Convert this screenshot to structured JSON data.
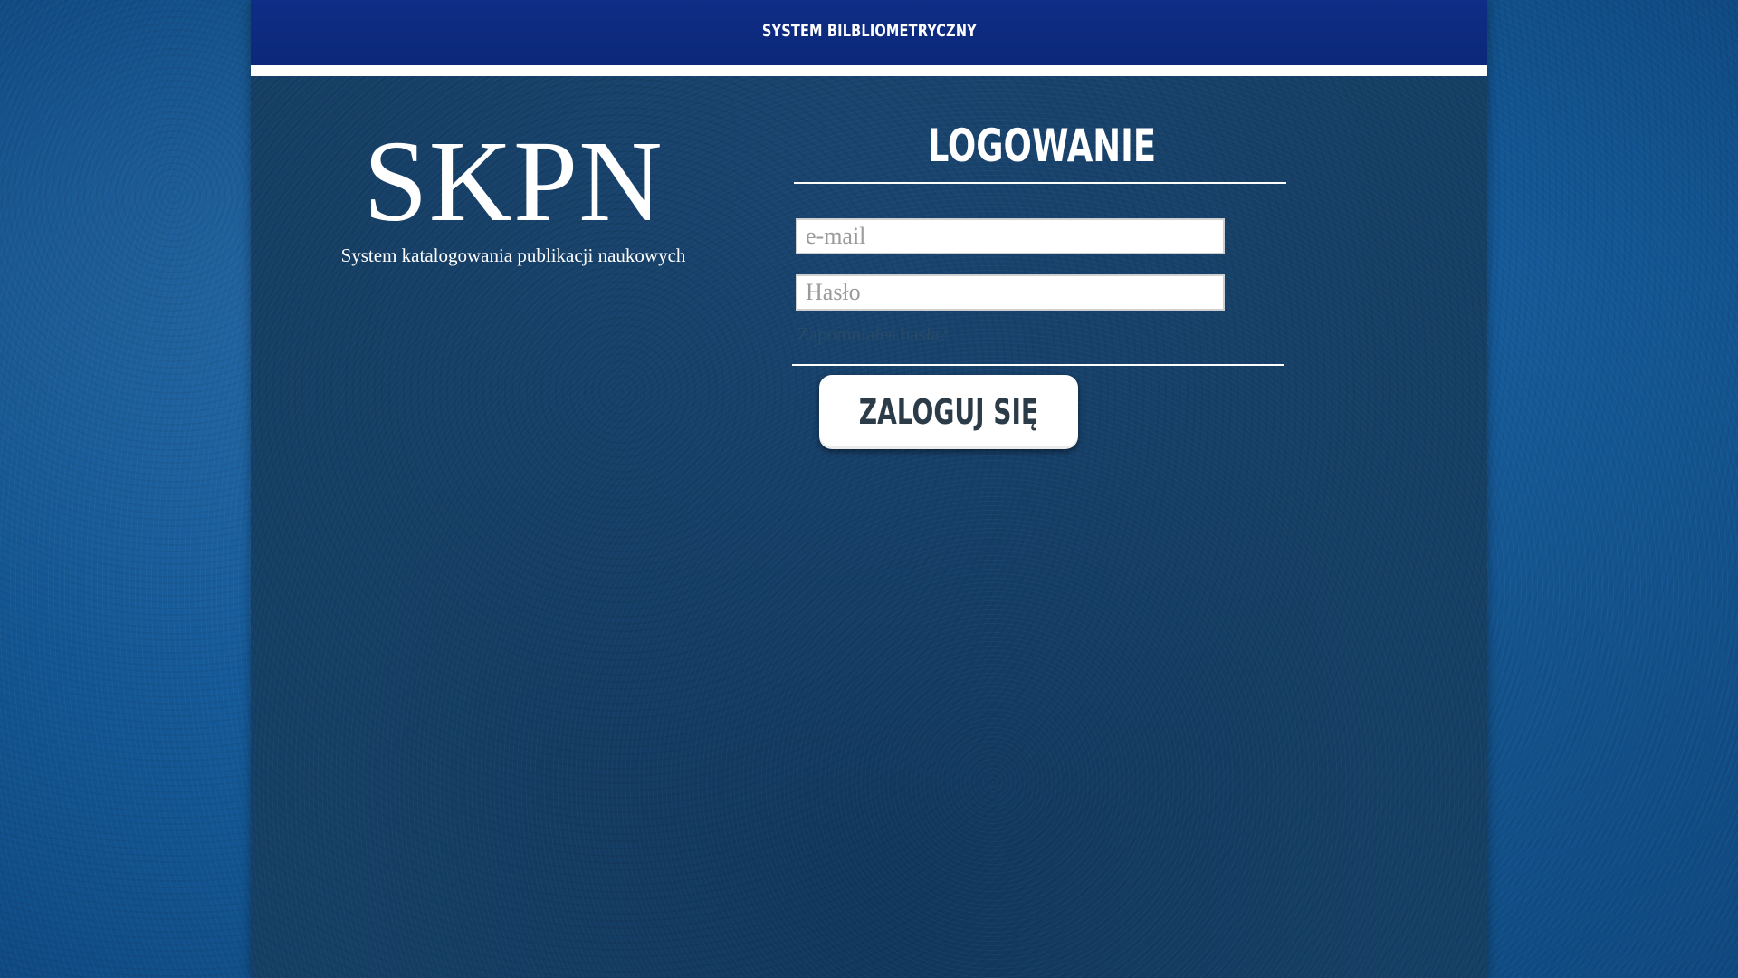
{
  "header": {
    "title": "System bilbliometryczny"
  },
  "brand": {
    "logo": "SKPN",
    "subtitle": "System katalogowania publikacji naukowych"
  },
  "login": {
    "title": "Logowanie",
    "email_placeholder": "e-mail",
    "password_placeholder": "Hasło",
    "forgot_link": "Zapomniałeś hasła?",
    "submit_label": "Zaloguj się"
  },
  "colors": {
    "header_bg": "#0f2d86",
    "panel_bg": "#163f66",
    "page_bg": "#1f6fb8",
    "button_bg": "#ffffff",
    "button_text": "#2b3b48"
  }
}
